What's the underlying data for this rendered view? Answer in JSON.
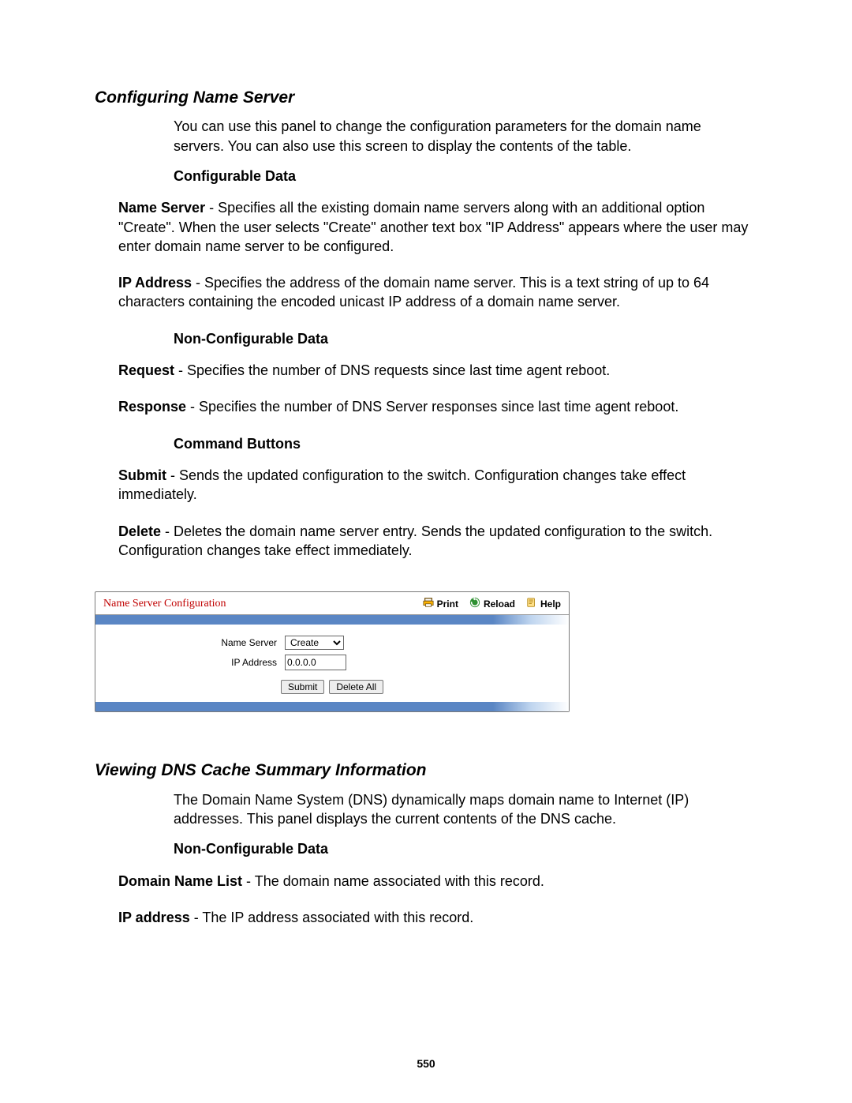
{
  "section1": {
    "title": "Configuring Name Server",
    "intro": "You can use this panel to change the configuration parameters for the domain name servers. You can also use this screen to display the contents of the table.",
    "sub_conf": "Configurable Data",
    "name_server": {
      "term": "Name Server",
      "text": " - Specifies all the existing domain name servers along with an additional option \"Create\". When the user selects \"Create\" another text box \"IP Address\" appears where the user may enter domain name server to be configured."
    },
    "ip_address": {
      "term": "IP Address",
      "text": " - Specifies the address of the domain name server. This is a text string of up to 64 characters containing the encoded unicast IP address of a domain name server."
    },
    "sub_nonconf": "Non-Configurable Data",
    "request": {
      "term": "Request",
      "text": " - Specifies the number of DNS requests since last time agent reboot."
    },
    "response": {
      "term": "Response",
      "text": " - Specifies the number of DNS Server responses since last time agent reboot."
    },
    "sub_cmd": "Command Buttons",
    "submit": {
      "term": "Submit",
      "text": " - Sends the updated configuration to the switch. Configuration changes take effect immediately."
    },
    "delete": {
      "term": "Delete",
      "text": " - Deletes the domain name server entry. Sends the updated configuration to the switch. Configuration changes take effect immediately."
    }
  },
  "panel": {
    "title": "Name Server Configuration",
    "tools": {
      "print": "Print",
      "reload": "Reload",
      "help": "Help"
    },
    "labels": {
      "name_server": "Name Server",
      "ip_address": "IP Address"
    },
    "name_server_option": "Create",
    "ip_value": "0.0.0.0",
    "buttons": {
      "submit": "Submit",
      "delete_all": "Delete All"
    }
  },
  "section2": {
    "title": "Viewing DNS Cache Summary Information",
    "intro": "The Domain Name System (DNS) dynamically maps domain name to Internet (IP) addresses. This panel displays the current contents of the DNS cache.",
    "sub_nonconf": "Non-Configurable Data",
    "domain_name_list": {
      "term": "Domain Name List",
      "text": " - The domain name associated with this record."
    },
    "ip_address": {
      "term": "IP address",
      "text": " - The IP address associated with this record."
    }
  },
  "page_number": "550"
}
